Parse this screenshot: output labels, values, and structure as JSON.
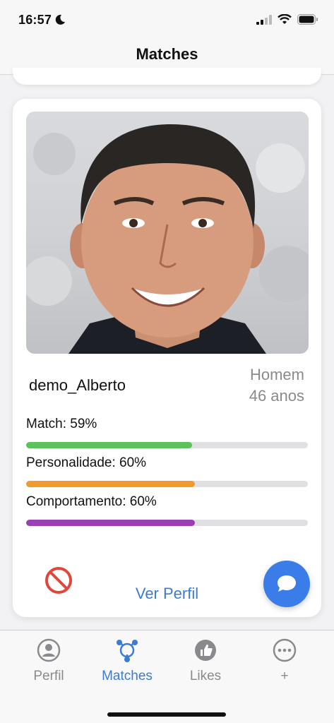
{
  "status_bar": {
    "time": "16:57"
  },
  "nav": {
    "title": "Matches"
  },
  "match": {
    "username": "demo_Alberto",
    "gender": "Homem",
    "age": "46 anos",
    "metrics": [
      {
        "label": "Match: 59%",
        "value": 59,
        "color": "#5cc25a"
      },
      {
        "label": "Personalidade: 60%",
        "value": 60,
        "color": "#f29a2e"
      },
      {
        "label": "Comportamento: 60%",
        "value": 60,
        "color": "#9b3fb5"
      }
    ],
    "view_profile": "Ver Perfil"
  },
  "tabs": [
    {
      "label": "Perfil",
      "icon": "person-circle-icon",
      "active": false
    },
    {
      "label": "Matches",
      "icon": "matches-icon",
      "active": true
    },
    {
      "label": "Likes",
      "icon": "thumbs-up-icon",
      "active": false
    },
    {
      "label": "+",
      "icon": "more-icon",
      "active": false
    }
  ],
  "colors": {
    "accent": "#3a7bd5",
    "block": "#e2463b"
  }
}
